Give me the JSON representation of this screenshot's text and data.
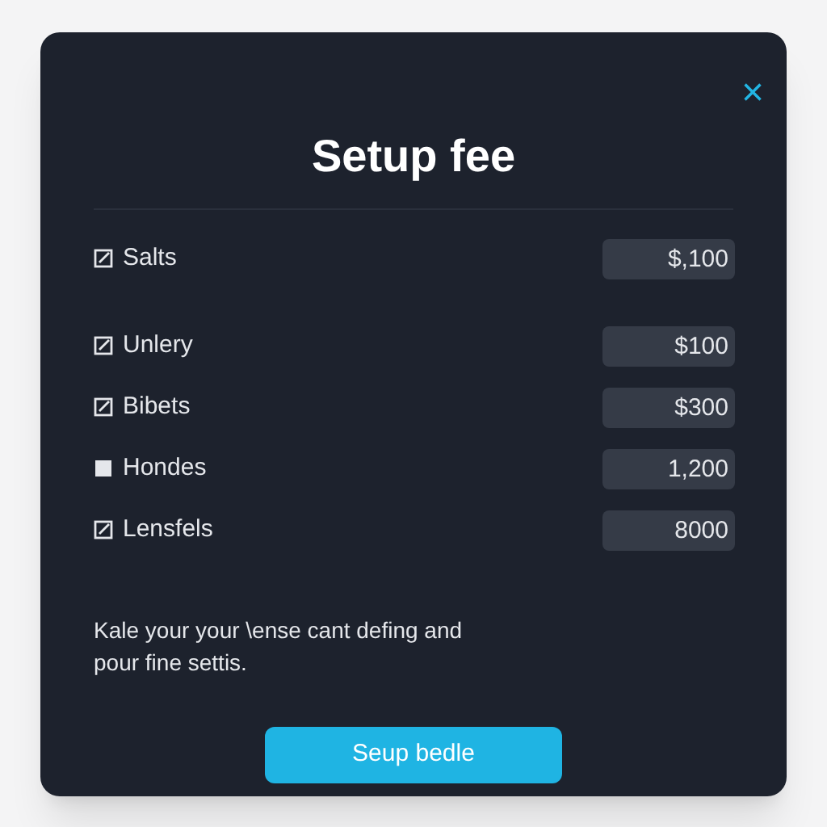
{
  "dialog": {
    "title": "Setup fee",
    "close": "×"
  },
  "items": [
    {
      "label": "Salts",
      "value": "$,100",
      "checked": true
    },
    {
      "label": "Unlery",
      "value": "$100",
      "checked": true
    },
    {
      "label": "Bibets",
      "value": "$300",
      "checked": true
    },
    {
      "label": "Hondes",
      "value": "1,200",
      "checked": false
    },
    {
      "label": "Lensfels",
      "value": "8000",
      "checked": true
    }
  ],
  "note": "Kale your your \\ense cant defing and pour fine settis.",
  "button": "Seup bedle"
}
